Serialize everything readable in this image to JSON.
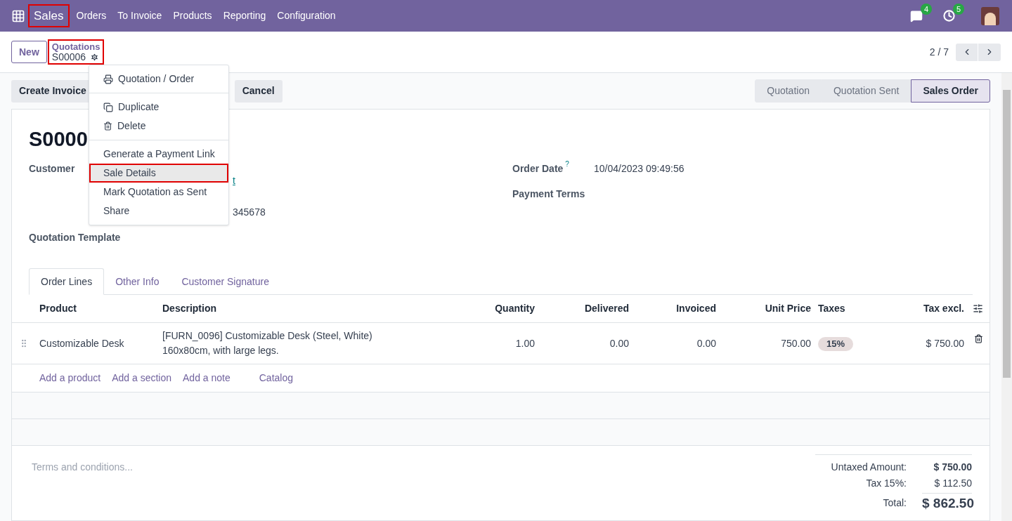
{
  "navbar": {
    "brand": {
      "label": "Sales",
      "highlighted": true
    },
    "menu": [
      "Orders",
      "To Invoice",
      "Products",
      "Reporting",
      "Configuration"
    ],
    "systray": [
      {
        "kind": "messages",
        "count": "4"
      },
      {
        "kind": "activities",
        "count": "5"
      }
    ]
  },
  "control_panel": {
    "new_button": "New",
    "breadcrumb": {
      "parent": "Quotations",
      "current": "S00006",
      "highlighted": true
    },
    "pager": "2 / 7"
  },
  "actions": [
    "Create Invoice",
    "Cancel"
  ],
  "stages": [
    {
      "label": "Quotation",
      "selected": false
    },
    {
      "label": "Quotation Sent",
      "selected": false
    },
    {
      "label": "Sales Order",
      "selected": true
    }
  ],
  "action_menu": [
    [
      {
        "kind": "print",
        "label": "Quotation / Order",
        "highlighted": false
      }
    ],
    [
      {
        "kind": "duplicate",
        "label": "Duplicate",
        "highlighted": false
      },
      {
        "kind": "delete",
        "label": "Delete",
        "highlighted": false
      }
    ],
    [
      {
        "kind": "plain",
        "label": "Generate a Payment Link",
        "highlighted": false
      },
      {
        "kind": "plain",
        "label": "Sale Details",
        "highlighted": true
      },
      {
        "kind": "plain",
        "label": "Mark Quotation as Sent",
        "highlighted": false
      },
      {
        "kind": "plain",
        "label": "Share",
        "highlighted": false
      }
    ]
  ],
  "form": {
    "title": "S0000",
    "customer": {
      "label": "Customer",
      "link_fragment": "t",
      "phone_fragment": "345678"
    },
    "quotation_template": {
      "label": "Quotation Template"
    },
    "order_date": {
      "label": "Order Date",
      "help": "?",
      "value": "10/04/2023 09:49:56"
    },
    "payment_terms": {
      "label": "Payment Terms"
    }
  },
  "tabs": [
    {
      "label": "Order Lines",
      "selected": true
    },
    {
      "label": "Other Info",
      "selected": false
    },
    {
      "label": "Customer Signature",
      "selected": false
    }
  ],
  "table": {
    "columns": [
      "Product",
      "Description",
      "Quantity",
      "Delivered",
      "Invoiced",
      "Unit Price",
      "Taxes",
      "Tax excl."
    ],
    "rows": [
      {
        "product": "Customizable Desk",
        "description": [
          "[FURN_0096] Customizable Desk (Steel, White)",
          "160x80cm, with large legs."
        ],
        "quantity": "1.00",
        "delivered": "0.00",
        "invoiced": "0.00",
        "unit_price": "750.00",
        "taxes": "15%",
        "tax_excl": "$ 750.00"
      }
    ],
    "add_links": [
      "Add a product",
      "Add a section",
      "Add a note",
      "Catalog"
    ]
  },
  "terms": {
    "placeholder": "Terms and conditions..."
  },
  "totals": [
    {
      "label": "Untaxed Amount:",
      "value": "$ 750.00",
      "kind": "subtotal"
    },
    {
      "label": "Tax 15%:",
      "value": "$ 112.50",
      "kind": "tax"
    },
    {
      "label": "Total:",
      "value": "$ 862.50",
      "kind": "total"
    }
  ]
}
